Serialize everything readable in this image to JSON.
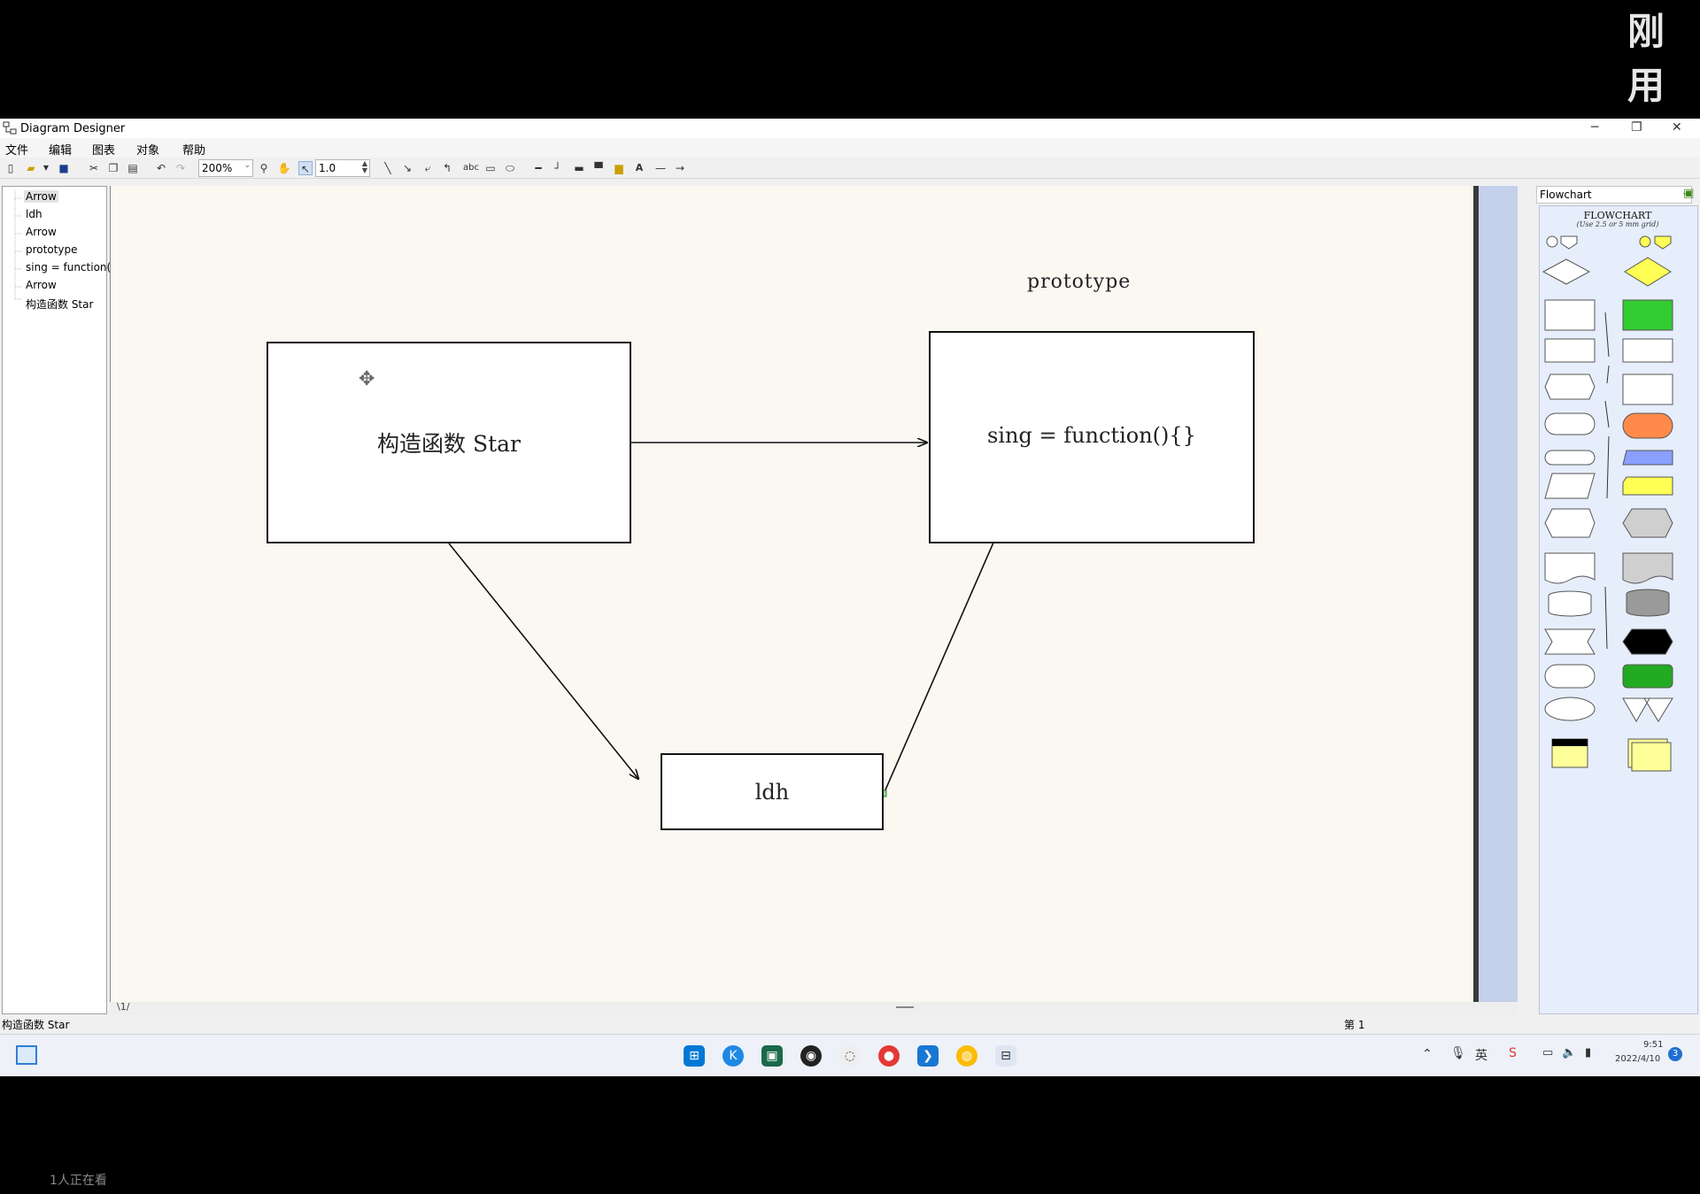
{
  "overlay": {
    "text": "刚用"
  },
  "window": {
    "title": "Diagram Designer",
    "min": "─",
    "max": "❐",
    "close": "✕"
  },
  "menu": [
    "文件",
    "编辑",
    "图表",
    "对象",
    "帮助"
  ],
  "toolbar": {
    "zoom": "200%",
    "line_width": "1.0",
    "text_tool": "abc"
  },
  "tree": [
    "Arrow",
    "ldh",
    "Arrow",
    "prototype",
    "sing = function(",
    "Arrow",
    "构造函数 Star"
  ],
  "diagram": {
    "prototype_label": "prototype",
    "star_box": "构造函数 Star",
    "proto_box": "sing = function(){}",
    "ldh_box": "ldh"
  },
  "palette": {
    "selected": "Flowchart",
    "heading": "FLOWCHART",
    "subheading": "(Use 2.5 or 5 mm grid)"
  },
  "canvas_tab": "1",
  "status": {
    "left": "构造函数 Star",
    "page": "第 1"
  },
  "tray": {
    "time": "9:51",
    "date": "2022/4/10",
    "ime": "英",
    "notifications": "3"
  },
  "viewers": "1人正在看",
  "colors": {
    "accent_green": "#22c422",
    "yellow": "#ffff55",
    "orange": "#ff8a4c",
    "blue": "#8aa0ff"
  }
}
